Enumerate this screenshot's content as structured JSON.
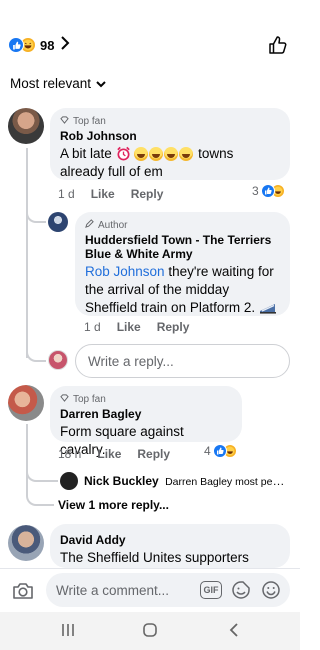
{
  "header": {
    "reaction_count": "98",
    "reactions": [
      "like-icon",
      "haha-icon"
    ]
  },
  "sort": {
    "label": "Most relevant"
  },
  "comments": [
    {
      "badge": "Top fan",
      "name": "Rob Johnson",
      "text_before": "A bit late",
      "text_after": "towns already full of em",
      "emoji_count": 4,
      "time": "1 d",
      "like": "Like",
      "reply": "Reply",
      "reaction_count": "3",
      "replies": [
        {
          "badge": "Author",
          "name": "Huddersfield Town - The Terriers Blue & White Army",
          "mention": "Rob Johnson",
          "text": "they're waiting for the arrival of the midday Sheffield train on Platform 2.",
          "time": "1 d",
          "like": "Like",
          "reply": "Reply"
        }
      ]
    },
    {
      "badge": "Top fan",
      "name": "Darren Bagley",
      "text": "Form square against cavalry.",
      "time": "18 h",
      "like": "Like",
      "reply": "Reply",
      "reaction_count": "4",
      "reply_preview": {
        "name": "Nick Buckley",
        "text": "Darren Bagley most peopl..."
      },
      "more_replies": "View 1 more reply..."
    },
    {
      "name": "David Addy",
      "text": "The Sheffield Unites supporters were"
    }
  ],
  "reply_box": {
    "placeholder": "Write a reply..."
  },
  "comment_box": {
    "placeholder": "Write a comment...",
    "gif_label": "GIF"
  },
  "colors": {
    "accent": "#1877f2",
    "mention": "#216fdb",
    "bubble": "#f0f2f5",
    "secondary_text": "#65676b"
  }
}
